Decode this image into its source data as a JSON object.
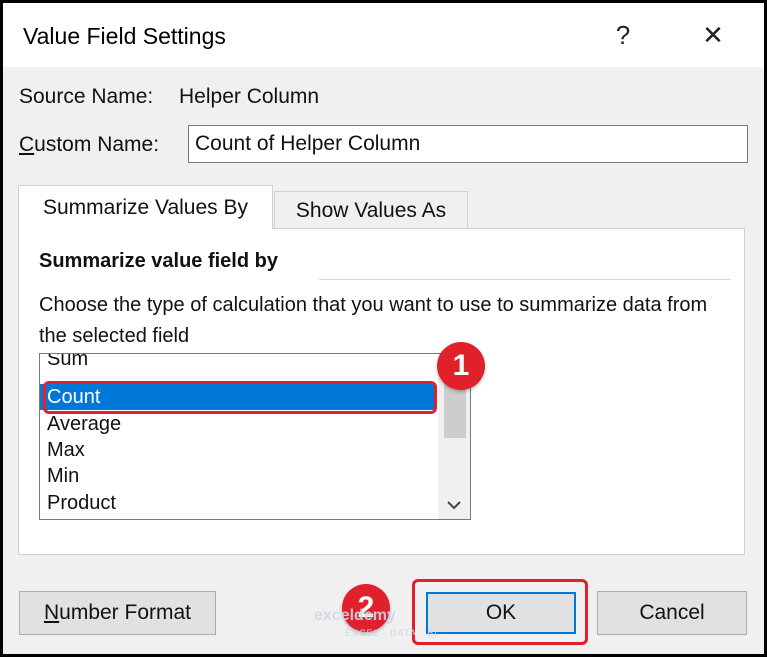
{
  "dialog": {
    "title": "Value Field Settings",
    "help_label": "?",
    "close_label": "✕"
  },
  "source": {
    "label": "Source Name:",
    "value": "Helper Column"
  },
  "custom_name": {
    "label_prefix": "C",
    "label_rest": "ustom Name:",
    "value": "Count of Helper Column"
  },
  "tabs": [
    {
      "label": "Summarize Values By",
      "active": true
    },
    {
      "label": "Show Values As",
      "active": false
    }
  ],
  "panel": {
    "section_title": "Summarize value field by",
    "description": "Choose the type of calculation that you want to use to summarize data from the selected field"
  },
  "list": {
    "items": [
      "Sum",
      "Count",
      "Average",
      "Max",
      "Min",
      "Product"
    ],
    "selected": "Count"
  },
  "buttons": {
    "number_format_prefix": "N",
    "number_format_rest": "umber Format",
    "ok": "OK",
    "cancel": "Cancel"
  },
  "badges": [
    "1",
    "2"
  ],
  "watermark": {
    "text": "exceldemy",
    "sub": "EXCEL · DATA · BI"
  },
  "colors": {
    "selection": "#0078d7",
    "annotation_red": "#e0202a"
  },
  "icons": {
    "scroll_down": "chevron-down-icon"
  }
}
